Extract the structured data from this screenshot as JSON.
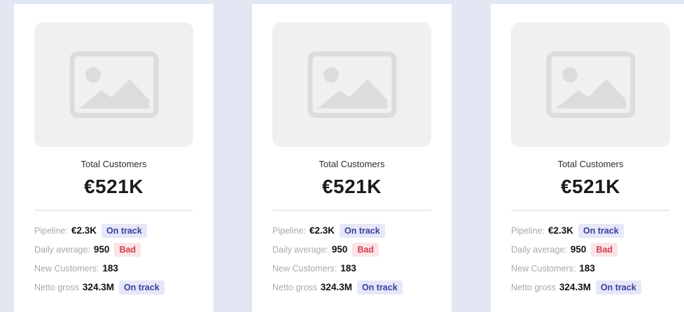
{
  "cards": [
    {
      "title": "Total Customers",
      "value": "€521K",
      "stats": [
        {
          "label": "Pipeline:",
          "value": "€2.3K",
          "badge": "On track",
          "badge_type": "on-track"
        },
        {
          "label": "Daily average:",
          "value": "950",
          "badge": "Bad",
          "badge_type": "bad"
        },
        {
          "label": "New Customers:",
          "value": "183"
        },
        {
          "label": "Netto gross",
          "value": "324.3M",
          "badge": "On track",
          "badge_type": "on-track"
        }
      ]
    },
    {
      "title": "Total Customers",
      "value": "€521K",
      "stats": [
        {
          "label": "Pipeline:",
          "value": "€2.3K",
          "badge": "On track",
          "badge_type": "on-track"
        },
        {
          "label": "Daily average:",
          "value": "950",
          "badge": "Bad",
          "badge_type": "bad"
        },
        {
          "label": "New Customers:",
          "value": "183"
        },
        {
          "label": "Netto gross",
          "value": "324.3M",
          "badge": "On track",
          "badge_type": "on-track"
        }
      ]
    },
    {
      "title": "Total Customers",
      "value": "€521K",
      "stats": [
        {
          "label": "Pipeline:",
          "value": "€2.3K",
          "badge": "On track",
          "badge_type": "on-track"
        },
        {
          "label": "Daily average:",
          "value": "950",
          "badge": "Bad",
          "badge_type": "bad"
        },
        {
          "label": "New Customers:",
          "value": "183"
        },
        {
          "label": "Netto gross",
          "value": "324.3M",
          "badge": "On track",
          "badge_type": "on-track"
        }
      ]
    }
  ],
  "colors": {
    "background": "#e3e6f3",
    "card": "#ffffff",
    "on_track_bg": "#e6e7f8",
    "on_track_text": "#3a3f9b",
    "bad_bg": "#fbe4e7",
    "bad_text": "#d0414f"
  },
  "icons": {
    "placeholder": "image-placeholder-icon"
  }
}
